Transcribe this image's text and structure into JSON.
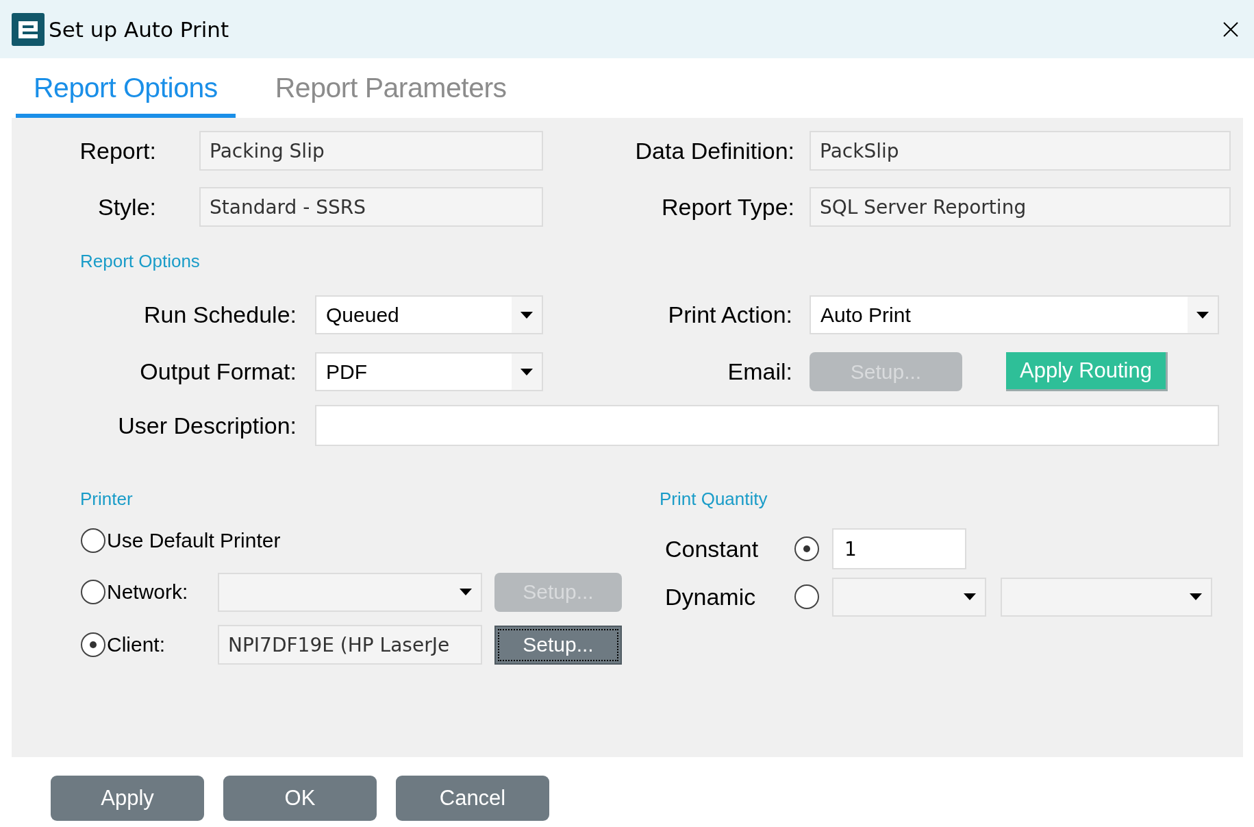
{
  "window": {
    "title": "Set up Auto Print"
  },
  "tabs": [
    {
      "label": "Report Options",
      "selected": true
    },
    {
      "label": "Report Parameters",
      "selected": false
    }
  ],
  "info": [
    {
      "label": "Report:",
      "value": "Packing Slip"
    },
    {
      "label": "Data Definition:",
      "value": "PackSlip"
    },
    {
      "label": "Style:",
      "value": "Standard - SSRS"
    },
    {
      "label": "Report Type:",
      "value": "SQL Server Reporting"
    }
  ],
  "report_options": {
    "heading": "Report Options",
    "run_schedule": {
      "label": "Run Schedule:",
      "value": "Queued"
    },
    "print_action": {
      "label": "Print Action:",
      "value": "Auto Print"
    },
    "output_format": {
      "label": "Output Format:",
      "value": "PDF"
    },
    "email": {
      "label": "Email:",
      "button": {
        "label": "Setup...",
        "disabled": true
      }
    },
    "apply_routing": {
      "label": "Apply Routing"
    },
    "user_description": {
      "label": "User Description:"
    }
  },
  "printer": {
    "heading": "Printer",
    "options": [
      {
        "kind": "plain",
        "label": "Use Default Printer",
        "selected": false
      },
      {
        "kind": "dropdown",
        "label": "Network:",
        "selected": false,
        "button": {
          "label": "Setup...",
          "disabled": true
        }
      },
      {
        "kind": "text",
        "label": "Client:",
        "value": "NPI7DF19E (HP LaserJe",
        "selected": true,
        "button": {
          "label": "Setup...",
          "disabled": false
        }
      }
    ]
  },
  "print_quantity": {
    "heading": "Print Quantity",
    "options": [
      {
        "kind": "number",
        "label": "Constant",
        "selected": true,
        "value": "1"
      },
      {
        "kind": "dropdowns",
        "label": "Dynamic",
        "selected": false
      }
    ]
  },
  "buttons": [
    "Apply",
    "OK",
    "Cancel"
  ]
}
